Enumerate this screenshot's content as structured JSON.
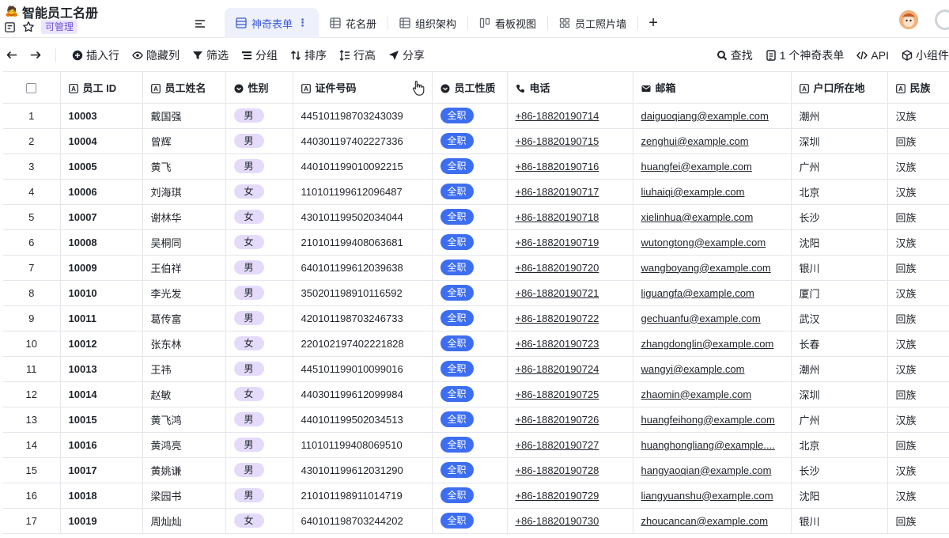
{
  "app": {
    "emoji": "🙇",
    "title": "智能员工名册",
    "permission": "可管理"
  },
  "tabs": [
    {
      "label": "神奇表单",
      "active": true,
      "icon": "form-icon",
      "more": "⋮"
    },
    {
      "label": "花名册",
      "active": false,
      "icon": "grid-icon"
    },
    {
      "label": "组织架构",
      "active": false,
      "icon": "grid-icon"
    },
    {
      "label": "看板视图",
      "active": false,
      "icon": "kanban-icon"
    },
    {
      "label": "员工照片墙",
      "active": false,
      "icon": "gallery-icon"
    }
  ],
  "tab_add": "+",
  "toolbar": {
    "insert_row": "插入行",
    "hide_cols": "隐藏列",
    "filter": "筛选",
    "group": "分组",
    "sort": "排序",
    "row_height": "行高",
    "share": "分享",
    "find": "查找",
    "forms": "1 个神奇表单",
    "api": "API",
    "widgets": "小组件"
  },
  "columns": [
    "员工 ID",
    "员工姓名",
    "性别",
    "证件号码",
    "员工性质",
    "电话",
    "邮箱",
    "户口所在地",
    "民族"
  ],
  "rows": [
    {
      "n": "1",
      "id": "10003",
      "name": "戴国强",
      "gender": "男",
      "idcard": "445101198703243039",
      "nature": "全职",
      "phone": "+86-18820190714",
      "email": "daiguoqiang@example.com",
      "city": "潮州",
      "ethnic": "汉族"
    },
    {
      "n": "2",
      "id": "10004",
      "name": "曾辉",
      "gender": "男",
      "idcard": "440301197402227336",
      "nature": "全职",
      "phone": "+86-18820190715",
      "email": "zenghui@example.com",
      "city": "深圳",
      "ethnic": "回族"
    },
    {
      "n": "3",
      "id": "10005",
      "name": "黄飞",
      "gender": "男",
      "idcard": "440101199010092215",
      "nature": "全职",
      "phone": "+86-18820190716",
      "email": "huangfei@example.com",
      "city": "广州",
      "ethnic": "汉族"
    },
    {
      "n": "4",
      "id": "10006",
      "name": "刘海琪",
      "gender": "女",
      "idcard": "110101199612096487",
      "nature": "全职",
      "phone": "+86-18820190717",
      "email": "liuhaiqi@example.com",
      "city": "北京",
      "ethnic": "汉族"
    },
    {
      "n": "5",
      "id": "10007",
      "name": "谢林华",
      "gender": "女",
      "idcard": "430101199502034044",
      "nature": "全职",
      "phone": "+86-18820190718",
      "email": "xielinhua@example.com",
      "city": "长沙",
      "ethnic": "回族"
    },
    {
      "n": "6",
      "id": "10008",
      "name": "吴桐同",
      "gender": "女",
      "idcard": "210101199408063681",
      "nature": "全职",
      "phone": "+86-18820190719",
      "email": "wutongtong@example.com",
      "city": "沈阳",
      "ethnic": "汉族"
    },
    {
      "n": "7",
      "id": "10009",
      "name": "王伯祥",
      "gender": "男",
      "idcard": "640101199612039638",
      "nature": "全职",
      "phone": "+86-18820190720",
      "email": "wangboyang@example.com",
      "city": "银川",
      "ethnic": "回族"
    },
    {
      "n": "8",
      "id": "10010",
      "name": "李光发",
      "gender": "男",
      "idcard": "350201198910116592",
      "nature": "全职",
      "phone": "+86-18820190721",
      "email": "liguangfa@example.com",
      "city": "厦门",
      "ethnic": "汉族"
    },
    {
      "n": "9",
      "id": "10011",
      "name": "葛传富",
      "gender": "男",
      "idcard": "420101198703246733",
      "nature": "全职",
      "phone": "+86-18820190722",
      "email": "gechuanfu@example.com",
      "city": "武汉",
      "ethnic": "回族"
    },
    {
      "n": "10",
      "id": "10012",
      "name": "张东林",
      "gender": "女",
      "idcard": "220102197402221828",
      "nature": "全职",
      "phone": "+86-18820190723",
      "email": "zhangdonglin@example.com",
      "city": "长春",
      "ethnic": "汉族"
    },
    {
      "n": "11",
      "id": "10013",
      "name": "王祎",
      "gender": "男",
      "idcard": "445101199010099016",
      "nature": "全职",
      "phone": "+86-18820190724",
      "email": "wangyi@example.com",
      "city": "潮州",
      "ethnic": "汉族"
    },
    {
      "n": "12",
      "id": "10014",
      "name": "赵敏",
      "gender": "女",
      "idcard": "440301199612099984",
      "nature": "全职",
      "phone": "+86-18820190725",
      "email": "zhaomin@example.com",
      "city": "深圳",
      "ethnic": "回族"
    },
    {
      "n": "13",
      "id": "10015",
      "name": "黄飞鸿",
      "gender": "男",
      "idcard": "440101199502034513",
      "nature": "全职",
      "phone": "+86-18820190726",
      "email": "huangfeihong@example.com",
      "city": "广州",
      "ethnic": "汉族"
    },
    {
      "n": "14",
      "id": "10016",
      "name": "黄鸿亮",
      "gender": "男",
      "idcard": "110101199408069510",
      "nature": "全职",
      "phone": "+86-18820190727",
      "email": "huanghongliang@example....",
      "city": "北京",
      "ethnic": "回族"
    },
    {
      "n": "15",
      "id": "10017",
      "name": "黄姚谦",
      "gender": "男",
      "idcard": "430101199612031290",
      "nature": "全职",
      "phone": "+86-18820190728",
      "email": "hangyaoqian@example.com",
      "city": "长沙",
      "ethnic": "汉族"
    },
    {
      "n": "16",
      "id": "10018",
      "name": "梁园书",
      "gender": "男",
      "idcard": "210101198911014719",
      "nature": "全职",
      "phone": "+86-18820190729",
      "email": "liangyuanshu@example.com",
      "city": "沈阳",
      "ethnic": "汉族"
    },
    {
      "n": "17",
      "id": "10019",
      "name": "周灿灿",
      "gender": "女",
      "idcard": "640101198703244202",
      "nature": "全职",
      "phone": "+86-18820190730",
      "email": "zhoucancan@example.com",
      "city": "银川",
      "ethnic": "回族"
    }
  ],
  "colors": {
    "accent": "#3b5bdb",
    "nature_tag": "#3e6ef0",
    "gender_tag": "#e4dbfb",
    "permission_bg": "#ece6fd"
  }
}
